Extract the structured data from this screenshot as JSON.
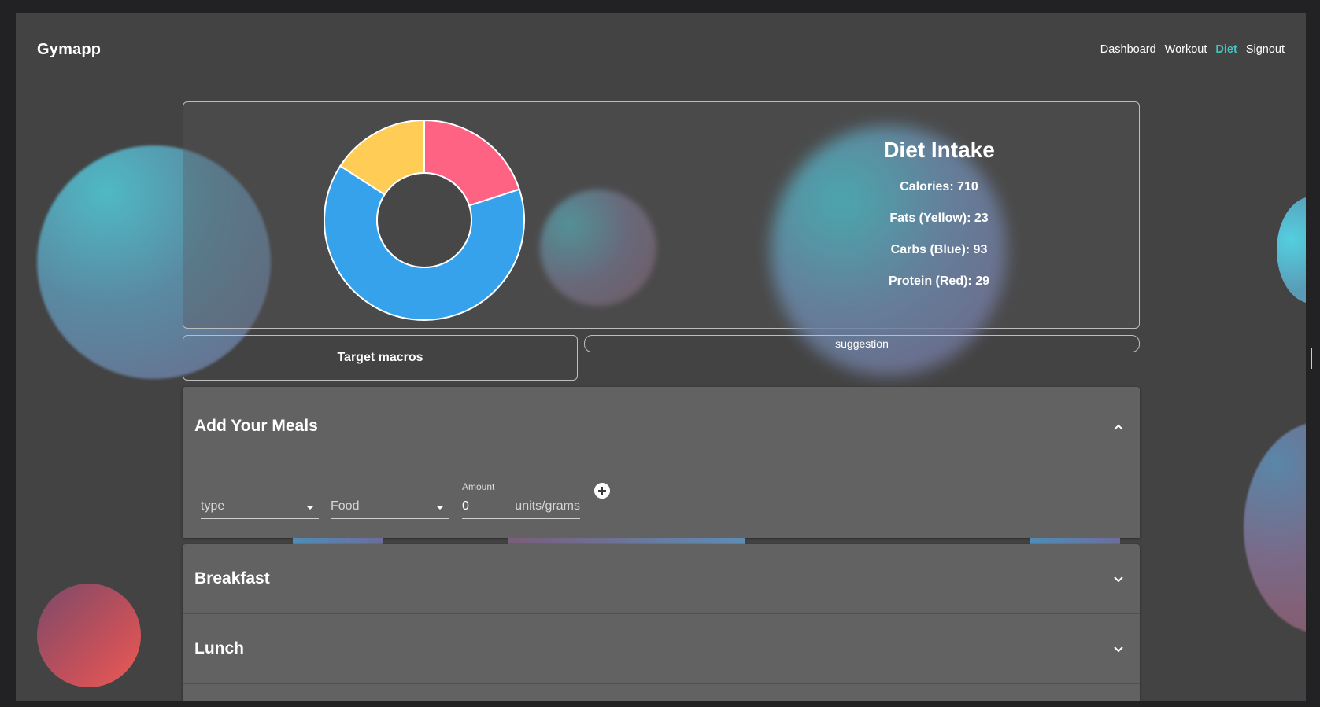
{
  "navbar": {
    "brand": "Gymapp",
    "links": [
      "Dashboard",
      "Workout",
      "Diet",
      "Signout"
    ],
    "active": "Diet"
  },
  "intake": {
    "title": "Diet Intake",
    "calories": "Calories: 710",
    "fats": "Fats (Yellow): 23",
    "carbs": "Carbs (Blue): 93",
    "protein": "Protein (Red): 29"
  },
  "chart_data": {
    "type": "pie",
    "categories": [
      "Protein",
      "Carbs",
      "Fats"
    ],
    "values": [
      29,
      93,
      23
    ],
    "colors": [
      "#ff6384",
      "#36a2eb",
      "#ffcd56"
    ],
    "style": "doughnut"
  },
  "target_macros_label": "Target macros",
  "suggestion_label": "suggestion",
  "add_meals": {
    "title": "Add Your Meals",
    "type_placeholder": "type",
    "food_placeholder": "Food",
    "amount_label": "Amount",
    "amount_value": "0",
    "amount_unit": "units/grams"
  },
  "meals": {
    "breakfast": "Breakfast",
    "lunch": "Lunch"
  },
  "icons": {
    "collapse": "chevron-up-icon",
    "expand": "chevron-down-icon",
    "add": "plus-circle-icon",
    "dropdown": "caret-down-icon"
  }
}
